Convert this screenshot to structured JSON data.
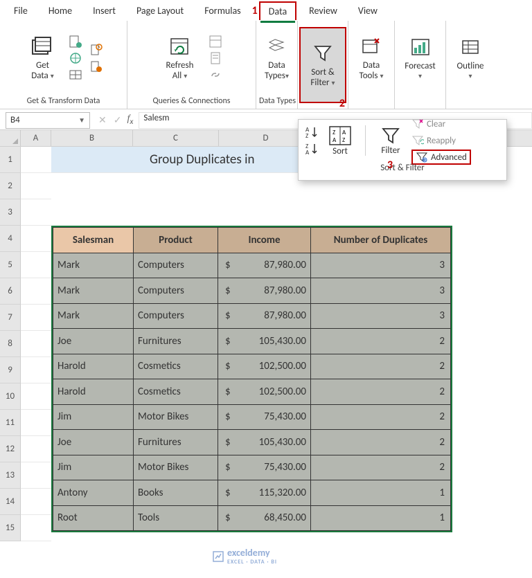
{
  "menu": {
    "items": [
      "File",
      "Home",
      "Insert",
      "Page Layout",
      "Formulas",
      "Data",
      "Review",
      "View"
    ],
    "active": "Data",
    "callout1": "1"
  },
  "ribbon": {
    "groups": [
      {
        "label": "Get & Transform Data",
        "big": {
          "name": "get-data-button",
          "line1": "Get",
          "line2": "Data"
        }
      },
      {
        "label": "Queries & Connections",
        "big": {
          "name": "refresh-all-button",
          "line1": "Refresh",
          "line2": "All"
        }
      },
      {
        "label": "Data Types",
        "big": {
          "name": "data-types-button",
          "line1": "Data",
          "line2": "Types"
        }
      }
    ],
    "sortfilter": {
      "label": "Sort &",
      "label2": "Filter",
      "callout2": "2"
    },
    "datatools": {
      "label": "Data",
      "label2": "Tools"
    },
    "forecast": {
      "label": "Forecast"
    },
    "outline": {
      "label": "Outline"
    }
  },
  "dropdown": {
    "sortAZ": "A→Z",
    "sortZA": "Z→A",
    "sort": "Sort",
    "filter": "Filter",
    "clear": "Clear",
    "reapply": "Reapply",
    "advanced": "Advanced",
    "group_label": "Sort & Filter",
    "callout3": "3"
  },
  "namebox": {
    "ref": "B4"
  },
  "formula": {
    "value": "Salesm"
  },
  "columns": [
    "A",
    "B",
    "C",
    "D"
  ],
  "row_headers": [
    "1",
    "2",
    "3",
    "4",
    "5",
    "6",
    "7",
    "8",
    "9",
    "10",
    "11",
    "12",
    "13",
    "14",
    "15"
  ],
  "title": "Group Duplicates in",
  "table": {
    "headers": [
      "Salesman",
      "Product",
      "Income",
      "Number of Duplicates"
    ],
    "rows": [
      {
        "s": "Mark",
        "p": "Computers",
        "i": "87,980.00",
        "n": "3"
      },
      {
        "s": "Mark",
        "p": "Computers",
        "i": "87,980.00",
        "n": "3"
      },
      {
        "s": "Mark",
        "p": "Computers",
        "i": "87,980.00",
        "n": "3"
      },
      {
        "s": "Joe",
        "p": "Furnitures",
        "i": "105,430.00",
        "n": "2"
      },
      {
        "s": "Harold",
        "p": "Cosmetics",
        "i": "102,500.00",
        "n": "2"
      },
      {
        "s": "Harold",
        "p": "Cosmetics",
        "i": "102,500.00",
        "n": "2"
      },
      {
        "s": "Jim",
        "p": "Motor Bikes",
        "i": "75,430.00",
        "n": "2"
      },
      {
        "s": "Joe",
        "p": "Furnitures",
        "i": "105,430.00",
        "n": "2"
      },
      {
        "s": "Jim",
        "p": "Motor Bikes",
        "i": "75,430.00",
        "n": "2"
      },
      {
        "s": "Antony",
        "p": "Books",
        "i": "115,320.00",
        "n": "1"
      },
      {
        "s": "Root",
        "p": "Tools",
        "i": "68,450.00",
        "n": "1"
      }
    ]
  },
  "watermark": {
    "brand": "exceldemy",
    "sub": "EXCEL · DATA · BI"
  }
}
